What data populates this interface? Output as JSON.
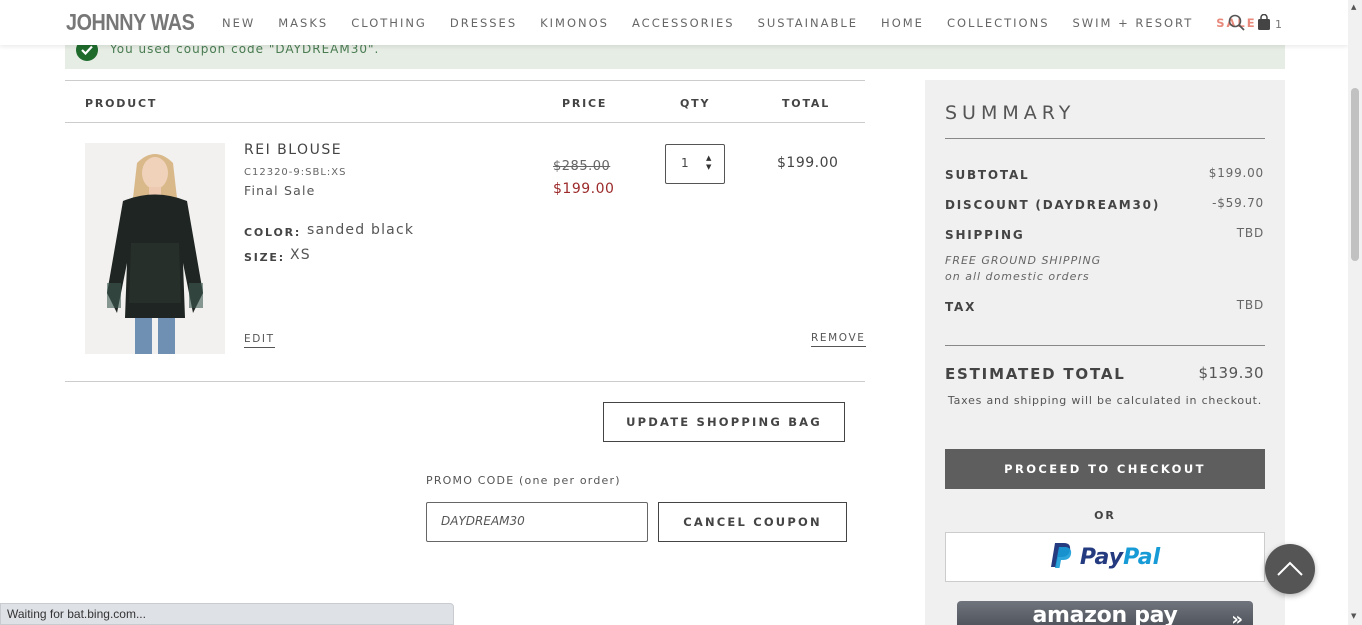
{
  "header": {
    "logo": "JOHNNY WAS",
    "nav": [
      "NEW",
      "MASKS",
      "CLOTHING",
      "DRESSES",
      "KIMONOS",
      "ACCESSORIES",
      "SUSTAINABLE",
      "HOME",
      "COLLECTIONS",
      "SWIM + RESORT",
      "SALE"
    ],
    "cart_count": "1",
    "sale_color": "#e8897c"
  },
  "banner": {
    "message": "You used coupon code \"DAYDREAM30\"."
  },
  "cart": {
    "headers": {
      "product": "PRODUCT",
      "price": "PRICE",
      "qty": "QTY",
      "total": "TOTAL"
    },
    "item": {
      "name": "REI BLOUSE",
      "sku": "C12320-9:SBL:XS",
      "final_sale": "Final Sale",
      "color_label": "COLOR:",
      "color_value": "sanded black",
      "size_label": "SIZE:",
      "size_value": "XS",
      "edit": "EDIT",
      "remove": "REMOVE",
      "price_original": "$285.00",
      "price_sale": "$199.00",
      "qty": "1",
      "total": "$199.00"
    },
    "update_button": "UPDATE SHOPPING BAG",
    "promo_label": "PROMO CODE (one per order)",
    "promo_value": "DAYDREAM30",
    "cancel_coupon": "CANCEL COUPON"
  },
  "summary": {
    "title": "SUMMARY",
    "subtotal_label": "SUBTOTAL",
    "subtotal_value": "$199.00",
    "discount_label": "DISCOUNT (DAYDREAM30)",
    "discount_value": "-$59.70",
    "shipping_label": "SHIPPING",
    "shipping_value": "TBD",
    "shipping_note_1": "FREE GROUND SHIPPING",
    "shipping_note_2": "on all domestic orders",
    "tax_label": "TAX",
    "tax_value": "TBD",
    "estimated_label": "ESTIMATED TOTAL",
    "estimated_value": "$139.30",
    "tax_note": "Taxes and shipping will be calculated in checkout.",
    "checkout_button": "PROCEED TO CHECKOUT",
    "or": "OR",
    "paypal_1": "Pay",
    "paypal_2": "Pal",
    "amazon": "amazon pay"
  },
  "status_bar": "Waiting for bat.bing.com..."
}
